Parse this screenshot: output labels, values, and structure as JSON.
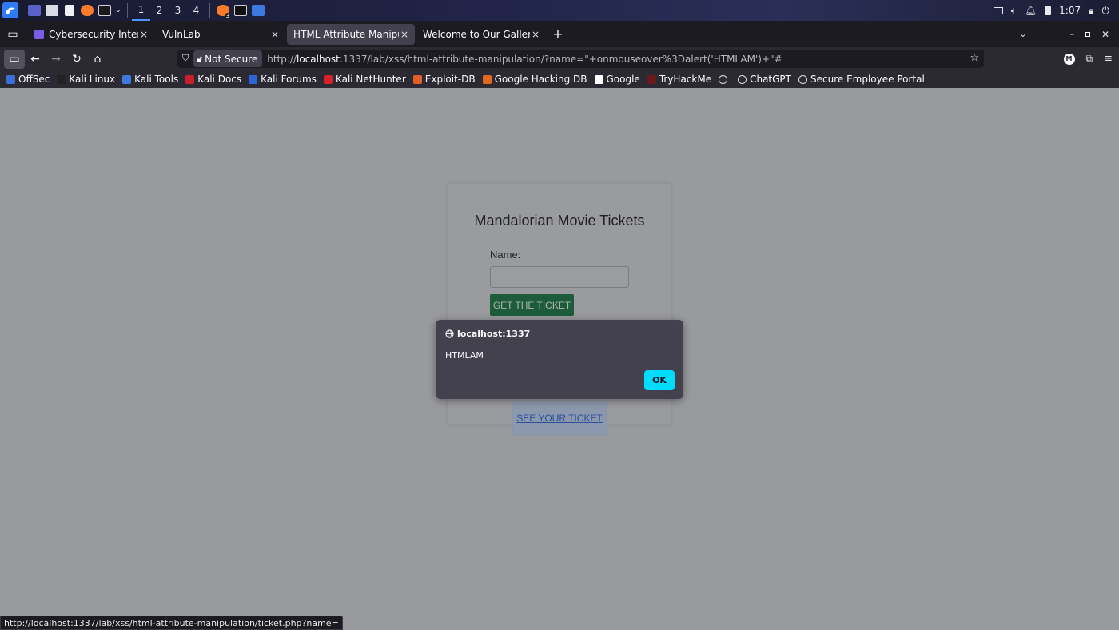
{
  "taskbar": {
    "workspaces": [
      "1",
      "2",
      "3",
      "4"
    ],
    "firefox_badge": "3",
    "clock": "1:07"
  },
  "tabs": [
    {
      "label": "Cybersecurity Intern – CTI",
      "close": "×"
    },
    {
      "label": "VulnLab",
      "close": "×"
    },
    {
      "label": "HTML Attribute Manipulation",
      "close": "×"
    },
    {
      "label": "Welcome to Our Gallery",
      "close": "×"
    }
  ],
  "tabbar": {
    "new_tab": "+"
  },
  "navbar": {
    "security_label": "Not Secure",
    "url_prefix": "http://",
    "url_host": "localhost",
    "url_rest": ":1337/lab/xss/html-attribute-manipulation/?name=\"+onmouseover%3Dalert('HTMLAM')+\"#",
    "profile_initial": "M"
  },
  "bookmarks": [
    {
      "label": "OffSec",
      "color": "#3a6fd8"
    },
    {
      "label": "Kali Linux",
      "color": "#222222"
    },
    {
      "label": "Kali Tools",
      "color": "#3d7ae0"
    },
    {
      "label": "Kali Docs",
      "color": "#c8202a"
    },
    {
      "label": "Kali Forums",
      "color": "#2d64d8"
    },
    {
      "label": "Kali NetHunter",
      "color": "#d8202a"
    },
    {
      "label": "Exploit-DB",
      "color": "#e0602a"
    },
    {
      "label": "Google Hacking DB",
      "color": "#e06a20"
    },
    {
      "label": "Google",
      "color": "#ffffff"
    },
    {
      "label": "TryHackMe",
      "color": "#6a1a1a"
    },
    {
      "label": "",
      "color": "#dddddd"
    },
    {
      "label": "ChatGPT",
      "color": "#dddddd"
    },
    {
      "label": "Secure Employee Portal",
      "color": "#dddddd"
    }
  ],
  "page": {
    "card_title": "Mandalorian Movie Tickets",
    "name_label": "Name:",
    "name_value": "",
    "ticket_button": "GET THE TICKET",
    "see_ticket_link": "SEE YOUR TICKET"
  },
  "dialog": {
    "origin": "localhost:1337",
    "message": "HTMLAM",
    "ok_label": "OK"
  },
  "status_url": "http://localhost:1337/lab/xss/html-attribute-manipulation/ticket.php?name=",
  "colors": {
    "accent": "#00ddff",
    "button_green": "#1d5b3b",
    "page_overlay": "#999a9e"
  }
}
